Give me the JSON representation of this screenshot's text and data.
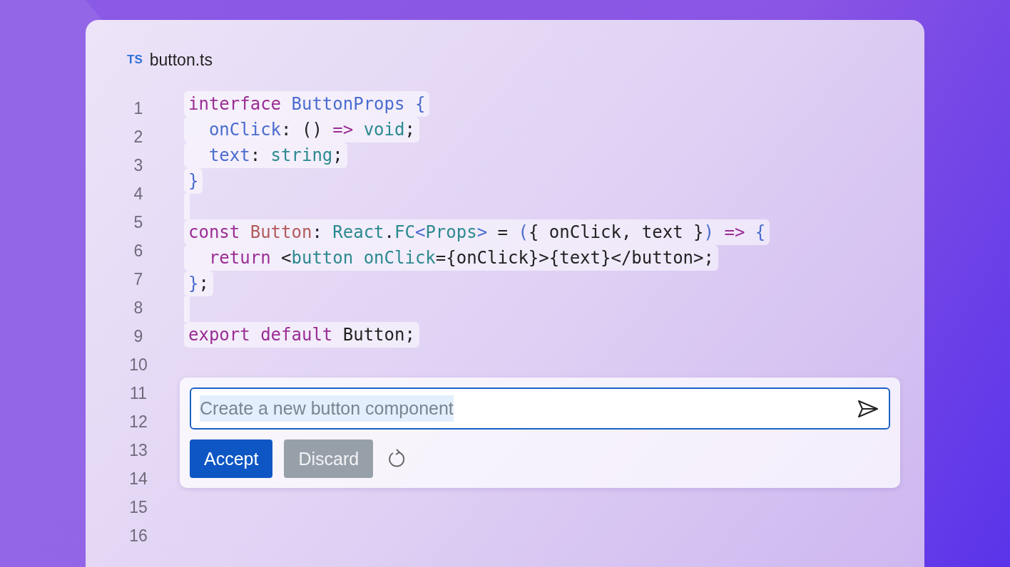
{
  "file": {
    "badge": "TS",
    "name": "button.ts"
  },
  "line_numbers": [
    "1",
    "2",
    "3",
    "4",
    "5",
    "6",
    "7",
    "8",
    "9",
    "10",
    "11",
    "12",
    "13",
    "14",
    "15",
    "16"
  ],
  "code_lines": [
    {
      "kind": "code",
      "indent": false,
      "tokens": [
        {
          "kind": "keyword",
          "text": "interface "
        },
        {
          "kind": "property",
          "text": "ButtonProps {"
        }
      ]
    },
    {
      "kind": "code",
      "indent": true,
      "tokens": [
        {
          "kind": "property",
          "text": "onClick"
        },
        {
          "kind": "plain",
          "text": ": () "
        },
        {
          "kind": "keyword",
          "text": "=> "
        },
        {
          "kind": "type",
          "text": "void"
        },
        {
          "kind": "plain",
          "text": ";"
        }
      ]
    },
    {
      "kind": "code",
      "indent": true,
      "tokens": [
        {
          "kind": "property",
          "text": "text"
        },
        {
          "kind": "plain",
          "text": ": "
        },
        {
          "kind": "type",
          "text": "string"
        },
        {
          "kind": "plain",
          "text": ";"
        }
      ]
    },
    {
      "kind": "code",
      "indent": false,
      "tokens": [
        {
          "kind": "property",
          "text": "}"
        }
      ]
    },
    {
      "kind": "blank"
    },
    {
      "kind": "code",
      "indent": false,
      "tokens": [
        {
          "kind": "keyword",
          "text": "const "
        },
        {
          "kind": "name",
          "text": "Button"
        },
        {
          "kind": "plain",
          "text": ": "
        },
        {
          "kind": "type",
          "text": "React"
        },
        {
          "kind": "plain",
          "text": "."
        },
        {
          "kind": "type",
          "text": "FC"
        },
        {
          "kind": "property",
          "text": "<"
        },
        {
          "kind": "type",
          "text": "Props"
        },
        {
          "kind": "property",
          "text": ">"
        },
        {
          "kind": "plain",
          "text": " = "
        },
        {
          "kind": "property",
          "text": "("
        },
        {
          "kind": "plain",
          "text": "{ onClick, text }"
        },
        {
          "kind": "property",
          "text": ") "
        },
        {
          "kind": "keyword",
          "text": "=> "
        },
        {
          "kind": "property",
          "text": "{"
        }
      ]
    },
    {
      "kind": "code",
      "indent": true,
      "tokens": [
        {
          "kind": "keyword",
          "text": "return "
        },
        {
          "kind": "plain",
          "text": "<"
        },
        {
          "kind": "type",
          "text": "button onClick"
        },
        {
          "kind": "plain",
          "text": "={onClick}>{text}</button>;"
        }
      ]
    },
    {
      "kind": "code",
      "indent": false,
      "tokens": [
        {
          "kind": "property",
          "text": "}"
        },
        {
          "kind": "plain",
          "text": ";"
        }
      ]
    },
    {
      "kind": "blank"
    },
    {
      "kind": "code",
      "indent": false,
      "tokens": [
        {
          "kind": "keyword",
          "text": "export default "
        },
        {
          "kind": "plain",
          "text": "Button;"
        }
      ]
    }
  ],
  "prompt": {
    "value": "Create a new button component",
    "selected": true
  },
  "buttons": [
    {
      "label": "Accept",
      "disabled": false
    },
    {
      "label": "Discard",
      "disabled": true
    }
  ]
}
